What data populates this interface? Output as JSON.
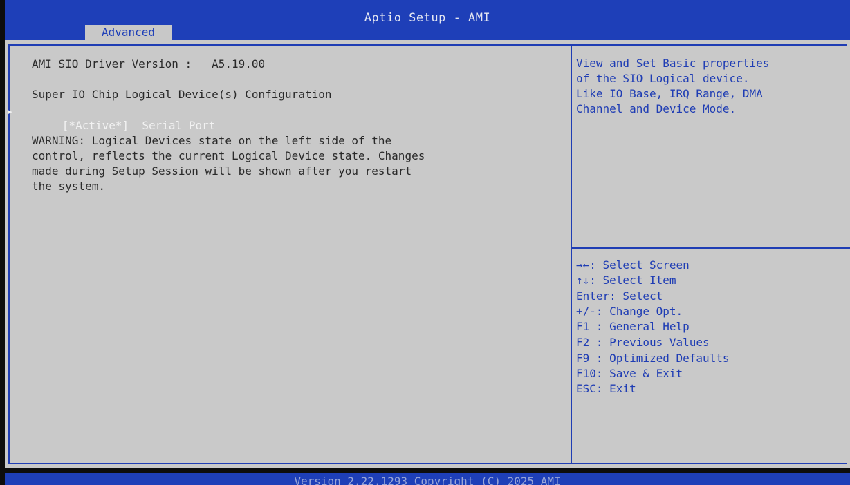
{
  "header": {
    "title": "Aptio Setup - AMI",
    "active_tab": "Advanced"
  },
  "main": {
    "driver_version": "AMI SIO Driver Version :   A5.19.00",
    "config_title": "Super IO Chip Logical Device(s) Configuration",
    "selected_item": {
      "status": "[*Active*]",
      "label": "Serial Port"
    },
    "warning_lines": [
      "WARNING: Logical Devices state on the left side of the",
      "control, reflects the current Logical Device state. Changes",
      "made during Setup Session will be shown after you restart",
      "the system."
    ]
  },
  "help": {
    "lines": [
      "View and Set Basic properties",
      "of the SIO Logical device.",
      "Like IO Base, IRQ Range, DMA",
      "Channel and Device Mode."
    ]
  },
  "keys": [
    "→←: Select Screen",
    "↑↓: Select Item",
    "Enter: Select",
    "+/-: Change Opt.",
    "F1 : General Help",
    "F2 : Previous Values",
    "F9 : Optimized Defaults",
    "F10: Save & Exit",
    "ESC: Exit"
  ],
  "footer": {
    "version": "Version 2.22.1293 Copyright (C) 2025 AMI"
  },
  "colors": {
    "bar_blue": "#1e3fb8",
    "panel_gray": "#c9c9c9",
    "text_dark": "#2a2a2a",
    "text_blue": "#1f3db4",
    "selection_white": "#f2f2f2"
  },
  "icons": {
    "submenu_indicator": "triangle-right-icon"
  }
}
